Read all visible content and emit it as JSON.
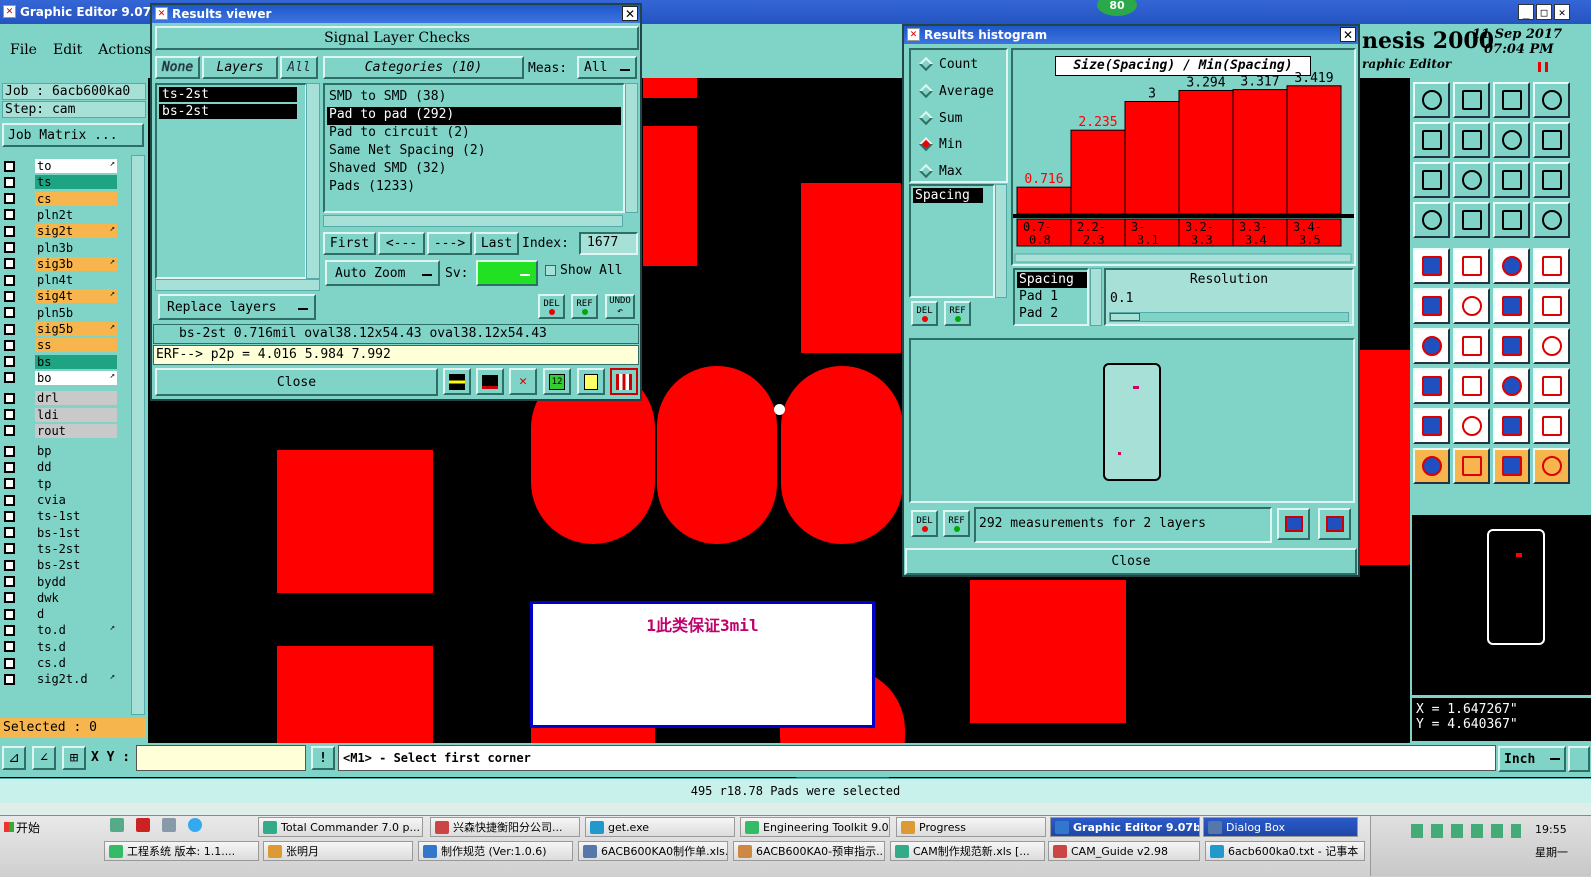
{
  "app": {
    "title": "Graphic Editor 9.07b2 (0",
    "menu": [
      "File",
      "Edit",
      "Actions"
    ],
    "job_label": "Job : 6acb600ka0",
    "step_label": "Step: cam",
    "job_matrix_btn": "Job Matrix ...",
    "selected_label": "Selected : 0",
    "brand": "nesis 2000",
    "brand_sub": "raphic Editor",
    "date": "11 Sep 2017",
    "time": "07:04 PM",
    "badge": "80",
    "coord_x": "X = 1.647267\"",
    "coord_y": "Y = 4.640367\"",
    "xy_label": "X Y :",
    "xy_value": "",
    "status_prompt": "<M1> - Select first corner",
    "units": "Inch",
    "status_bottom": "495 r18.78 Pads were selected"
  },
  "layers": [
    {
      "name": "to",
      "color": "#ffffff",
      "mark": true
    },
    {
      "name": "ts",
      "color": "#1ea482",
      "mark": false
    },
    {
      "name": "cs",
      "color": "#f6b64d",
      "mark": false
    },
    {
      "name": "pln2t",
      "color": "#7fd3c7",
      "mark": false
    },
    {
      "name": "sig2t",
      "color": "#f6b64d",
      "mark": true
    },
    {
      "name": "pln3b",
      "color": "#7fd3c7",
      "mark": false
    },
    {
      "name": "sig3b",
      "color": "#f6b64d",
      "mark": true
    },
    {
      "name": "pln4t",
      "color": "#7fd3c7",
      "mark": false
    },
    {
      "name": "sig4t",
      "color": "#f6b64d",
      "mark": true
    },
    {
      "name": "pln5b",
      "color": "#7fd3c7",
      "mark": false
    },
    {
      "name": "sig5b",
      "color": "#f6b64d",
      "mark": true
    },
    {
      "name": "ss",
      "color": "#f6b64d",
      "mark": false
    },
    {
      "name": "bs",
      "color": "#1ea482",
      "mark": false
    },
    {
      "name": "bo",
      "color": "#ffffff",
      "mark": true
    },
    {
      "name": "drl",
      "color": "#c9c9c9",
      "mark": false
    },
    {
      "name": "ldi",
      "color": "#c9c9c9",
      "mark": false
    },
    {
      "name": "rout",
      "color": "#c9c9c9",
      "mark": false
    },
    {
      "name": "bp",
      "color": "#7fd3c7",
      "mark": false
    },
    {
      "name": "dd",
      "color": "#7fd3c7",
      "mark": false
    },
    {
      "name": "tp",
      "color": "#7fd3c7",
      "mark": false
    },
    {
      "name": "cvia",
      "color": "#7fd3c7",
      "mark": false
    },
    {
      "name": "ts-1st",
      "color": "#7fd3c7",
      "mark": false
    },
    {
      "name": "bs-1st",
      "color": "#7fd3c7",
      "mark": false
    },
    {
      "name": "ts-2st",
      "color": "#7fd3c7",
      "mark": false
    },
    {
      "name": "bs-2st",
      "color": "#7fd3c7",
      "mark": false
    },
    {
      "name": "bydd",
      "color": "#7fd3c7",
      "mark": false
    },
    {
      "name": "dwk",
      "color": "#7fd3c7",
      "mark": false
    },
    {
      "name": "d",
      "color": "#7fd3c7",
      "mark": false
    },
    {
      "name": "to.d",
      "color": "#7fd3c7",
      "mark": true
    },
    {
      "name": "ts.d",
      "color": "#7fd3c7",
      "mark": false
    },
    {
      "name": "cs.d",
      "color": "#7fd3c7",
      "mark": false
    },
    {
      "name": "sig2t.d",
      "color": "#7fd3c7",
      "mark": true
    }
  ],
  "results_viewer": {
    "title": "Results viewer",
    "header": "Signal Layer Checks",
    "none_btn": "None",
    "layers_btn": "Layers",
    "all_btn": "All",
    "layer_items": [
      "ts-2st",
      "bs-2st"
    ],
    "categories_btn": "Categories (10)",
    "meas_label": "Meas:",
    "meas_value": "All",
    "categories": [
      "SMD to SMD (38)",
      "Pad to pad (292)",
      "Pad to circuit (2)",
      "Same Net Spacing (2)",
      "Shaved SMD (32)",
      "Pads (1233)"
    ],
    "first_btn": "First",
    "prev_btn": "<---",
    "next_btn": "--->",
    "last_btn": "Last",
    "index_label": "Index:",
    "index_value": "1677",
    "auto_zoom": "Auto Zoom",
    "sv_label": "Sv:",
    "show_all": "Show All",
    "replace_layers": "Replace layers",
    "del": "DEL",
    "ref": "REF",
    "undo": "UNDO",
    "info_line": "bs-2st 0.716mil  oval38.12x54.43  oval38.12x54.43",
    "erf_line": "ERF--> p2p = 4.016 5.984 7.992",
    "close": "Close"
  },
  "histogram": {
    "title": "Results histogram",
    "modes": [
      "Count",
      "Average",
      "Sum",
      "Min",
      "Max"
    ],
    "selected_mode": "Min",
    "measure_items": [
      "Spacing"
    ],
    "chart_title": "Size(Spacing) / Min(Spacing)",
    "del": "DEL",
    "ref": "REF",
    "spacing_items": [
      "Spacing",
      "Pad 1",
      "Pad 2"
    ],
    "resolution_label": "Resolution",
    "resolution_value": "0.1",
    "measurements_text": "292 measurements for 2 layers",
    "close": "Close"
  },
  "canvas_note": "1此类保证3mil",
  "taskbar": {
    "start": "开始",
    "row1": [
      "Total Commander 7.0 p...",
      "兴森快捷衡阳分公司...",
      "get.exe",
      "Engineering Toolkit 9.07...",
      "Progress",
      "Graphic Editor 9.07b...",
      "Dialog Box"
    ],
    "row2": [
      "工程系统  版本: 1.1....",
      "张明月",
      "制作规范 (Ver:1.0.6)",
      "6ACB600KA0制作单.xls...",
      "6ACB600KA0-预审指示...",
      "CAM制作规范新.xls [...",
      "CAM_Guide v2.98",
      "6acb600ka0.txt - 记事本"
    ],
    "clock": "19:55",
    "day": "星期一"
  },
  "chart_data": {
    "type": "bar",
    "title": "Size(Spacing) / Min(Spacing)",
    "categories": [
      "0.7-0.8",
      "2.2-2.3",
      "3-3.1",
      "3.2-3.3",
      "3.3-3.4",
      "3.4-3.5"
    ],
    "values": [
      0.716,
      2.235,
      3,
      3.294,
      3.317,
      3.419
    ],
    "bar_labels": [
      "0.716",
      "2.235",
      "3",
      "3.294",
      "3.317",
      "3.419"
    ],
    "ylim": [
      0,
      3.6
    ],
    "colors": {
      "bar": "#ff0000",
      "highlight_label": "#ff0000"
    }
  }
}
